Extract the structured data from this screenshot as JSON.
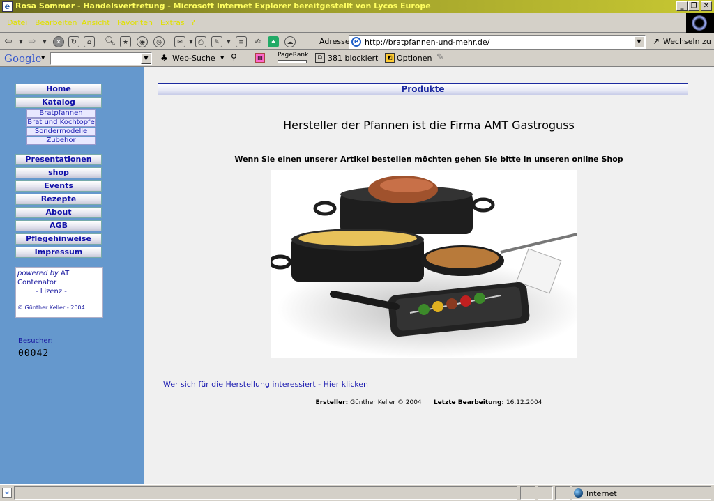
{
  "window": {
    "title": "Rosa Sommer - Handelsvertretung - Microsoft Internet Explorer bereitgestellt von Lycos Europe",
    "controls": [
      "_",
      "❐",
      "✕"
    ]
  },
  "menubar": {
    "items": [
      "Datei",
      "Bearbeiten",
      "Ansicht",
      "Favoriten",
      "Extras",
      "?"
    ]
  },
  "address": {
    "label": "Adresse",
    "url": "http://bratpfannen-und-mehr.de/",
    "go_label": "Wechseln zu"
  },
  "google_toolbar": {
    "logo": "Google",
    "search_label": "Web-Suche",
    "pagerank_label": "PageRank",
    "blocked_label": "381 blockiert",
    "options_label": "Optionen"
  },
  "sidebar": {
    "nav": [
      "Home",
      "Katalog"
    ],
    "sub": [
      "Bratpfannen",
      "Brat und Kochtopfe",
      "Sondermodelle",
      "Zubehor"
    ],
    "nav2": [
      "Presentationen",
      "shop",
      "Events",
      "Rezepte",
      "About",
      "AGB",
      "Pflegehinweise",
      "Impressum"
    ],
    "powered": {
      "by": "powered by",
      "name": "AT",
      "name2": "Contenator",
      "license": "- Lizenz -",
      "copyright": "© Günther Keller - 2004"
    },
    "visitors_label": "Besucher:",
    "visitors_count": "00042"
  },
  "main": {
    "section_title": "Produkte",
    "headline": "Hersteller der Pfannen ist die Firma AMT Gastroguss",
    "subline": "Wenn Sie einen unserer Artikel bestellen möchten gehen Sie bitte in unseren online Shop",
    "link": "Wer sich für die Herstellung interessiert - Hier klicken",
    "footer": {
      "author_label": "Ersteller:",
      "author": "Günther Keller © 2004",
      "edit_label": "Letzte Bearbeitung:",
      "edit_date": "16.12.2004"
    }
  },
  "statusbar": {
    "zone": "Internet"
  }
}
